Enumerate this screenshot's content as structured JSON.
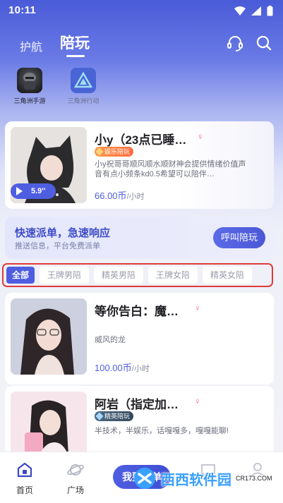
{
  "status_bar": {
    "time": "10:11"
  },
  "header": {
    "tabs": [
      {
        "label": "护航"
      },
      {
        "label": "陪玩"
      }
    ]
  },
  "games": [
    {
      "label": "三角洲手游"
    },
    {
      "label": "三角洲行动"
    }
  ],
  "featured": {
    "name": "小y（23点已睡…",
    "gender": "♀",
    "badge": "娱乐陪玩",
    "description": "小y祝哥哥顺风顺水顺财神会提供情绪价值声音有点小频条kd0.5希望可以陪伴…",
    "duration": "5.9''",
    "price": "66.00",
    "price_unit": "币",
    "per": "/小时"
  },
  "dispatch": {
    "title": "快速派单，急速响应",
    "subtitle": "推送信息，平台免费派单",
    "button": "呼叫陪玩"
  },
  "filters": [
    "全部",
    "王牌男陪",
    "精英男陪",
    "王牌女陪",
    "精英女陪"
  ],
  "companions": [
    {
      "name": "等你告白：魔…",
      "gender": "♀",
      "description": "威风的龙",
      "price": "100.00",
      "price_unit": "币",
      "per": "/小时"
    },
    {
      "name": "阿岩（指定加…",
      "gender": "♀",
      "badge": "精英陪玩",
      "description": "半技术，半娱乐，话嘎嘎多，嘎嘎能聊!"
    }
  ],
  "bottom_nav": {
    "home": "首页",
    "square": "广场",
    "order": "我要下单"
  },
  "watermark": {
    "text": "西西软件园",
    "sub": "CR173.COM"
  },
  "colors": {
    "accent": "#4f5ee0",
    "header_top": "#4a5bd8",
    "female": "#ff5fa2",
    "highlight_border": "#e03a3a"
  }
}
